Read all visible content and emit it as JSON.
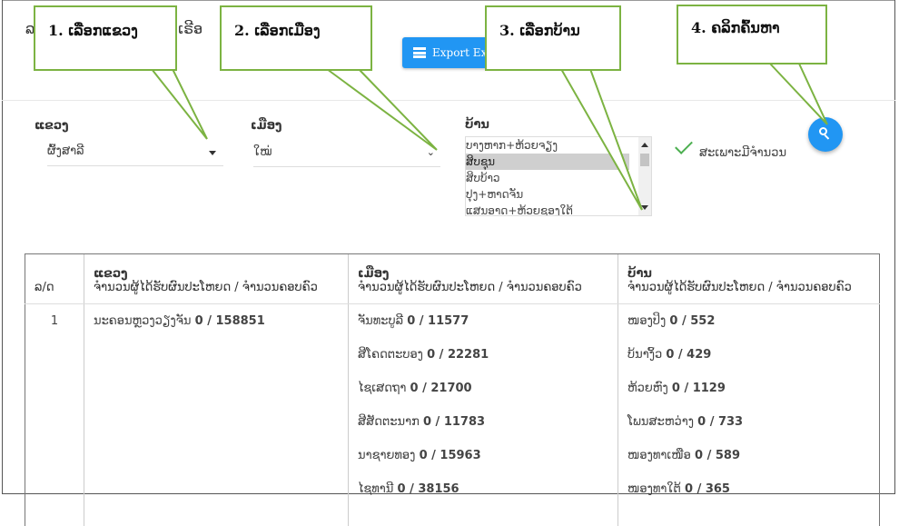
{
  "page_title": {
    "part1": "ລ",
    "part2": "ົວເຣີອ"
  },
  "export_button": {
    "label": "Export Exc"
  },
  "callouts": [
    {
      "label": "1. ເລືອກແຂວງ"
    },
    {
      "label": "2. ເລືອກເມືອງ"
    },
    {
      "label": "3. ເລືອກບ້ານ"
    },
    {
      "label": "4. ຄລິກຄົ້ນຫາ"
    }
  ],
  "filters": {
    "province": {
      "label": "ແຂວງ",
      "value": "ຜົ້ງສາລີ"
    },
    "district": {
      "label": "ເມືອງ",
      "value": "ໃໝ່"
    },
    "village": {
      "label": "ບ້ານ",
      "options": [
        {
          "label": "ບາງຫາກ+ຫ້ວຍຈຽງ",
          "selected": false
        },
        {
          "label": "ສິບຊຸນ",
          "selected": true
        },
        {
          "label": "ສິບບ້າວ",
          "selected": false
        },
        {
          "label": "ປຸງ+ຫາດຈັນ",
          "selected": false
        },
        {
          "label": "ແສນອາດ+ຫ້ວຍຊອງໃຕ້",
          "selected": false
        }
      ]
    },
    "only_with_count": {
      "label": "ສະເພາະມີຈຳນວນ",
      "checked": true
    }
  },
  "table": {
    "headers": [
      {
        "line1": "",
        "line2": "ລ/ດ"
      },
      {
        "line1": "ແຂວງ",
        "line2": "ຈຳນວນຜູ້ໄດ້ຮັບຜົນປະໂຫຍດ / ຈຳນວນຄອບຄົວ"
      },
      {
        "line1": "ເມືອງ",
        "line2": "ຈຳນວນຜູ້ໄດ້ຮັບຜົນປະໂຫຍດ / ຈຳນວນຄອບຄົວ"
      },
      {
        "line1": "ບ້ານ",
        "line2": "ຈຳນວນຜູ້ໄດ້ຮັບຜົນປະໂຫຍດ / ຈຳນວນຄອບຄົວ"
      }
    ],
    "rows": [
      {
        "index": "1",
        "province": {
          "name": "ນະຄອນຫຼວງວຽງຈັນ",
          "count": "0 / 158851"
        },
        "districts": [
          {
            "name": "ຈັນທະບູລີ",
            "count": "0 / 11577"
          },
          {
            "name": "ສີໂຄດຕະບອງ",
            "count": "0 / 22281"
          },
          {
            "name": "ໄຊເສດຖາ",
            "count": "0 / 21700"
          },
          {
            "name": "ສີສັດຕະນາກ",
            "count": "0 / 11783"
          },
          {
            "name": "ນາຊາຍທອງ",
            "count": "0 / 15963"
          },
          {
            "name": "ໄຊທານີ",
            "count": "0 / 38156"
          }
        ],
        "villages": [
          {
            "name": "ໜອງປິງ",
            "count": "0 / 552"
          },
          {
            "name": "ບ້ນາງິ້ວ",
            "count": "0 / 429"
          },
          {
            "name": "ຫ້ວຍຫົງ",
            "count": "0 / 1129"
          },
          {
            "name": "ໂພນສະຫວ່າງ",
            "count": "0 / 733"
          },
          {
            "name": "ໜອງທາເໜືອ",
            "count": "0 / 589"
          },
          {
            "name": "ໜອງທາໃຕ້",
            "count": "0 / 365"
          }
        ]
      }
    ]
  },
  "colors": {
    "accent": "#2196f3",
    "callout_border": "#7cb342",
    "check": "#4caf50",
    "selected_option": "#cfcfcf"
  }
}
